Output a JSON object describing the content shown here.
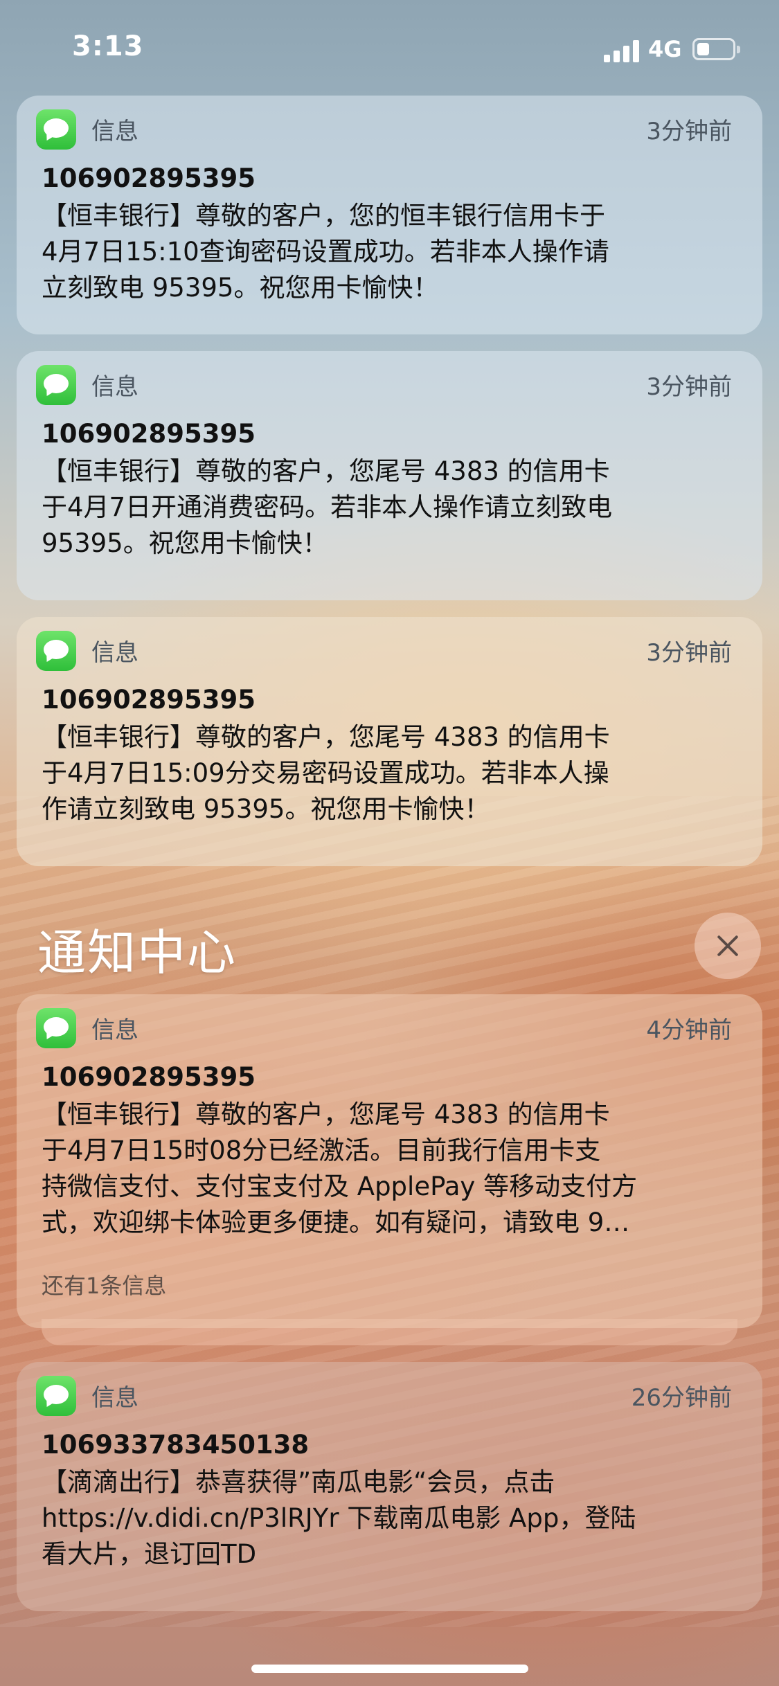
{
  "status_bar": {
    "time": "3:13",
    "network": "4G"
  },
  "notification_center": {
    "title": "通知中心"
  },
  "notifications": [
    {
      "app": "信息",
      "time_ago": "3分钟前",
      "sender": "106902895395",
      "lines": [
        "【恒丰银行】尊敬的客户，您的恒丰银行信用卡于",
        "4月7日15:10查询密码设置成功。若非本人操作请",
        "立刻致电 95395。祝您用卡愉快！"
      ]
    },
    {
      "app": "信息",
      "time_ago": "3分钟前",
      "sender": "106902895395",
      "lines": [
        "【恒丰银行】尊敬的客户，您尾号 4383 的信用卡",
        "于4月7日开通消费密码。若非本人操作请立刻致电",
        "95395。祝您用卡愉快！"
      ]
    },
    {
      "app": "信息",
      "time_ago": "3分钟前",
      "sender": "106902895395",
      "lines": [
        "【恒丰银行】尊敬的客户，您尾号 4383 的信用卡",
        "于4月7日15:09分交易密码设置成功。若非本人操",
        "作请立刻致电 95395。祝您用卡愉快！"
      ]
    },
    {
      "app": "信息",
      "time_ago": "4分钟前",
      "sender": "106902895395",
      "lines": [
        "【恒丰银行】尊敬的客户，您尾号 4383 的信用卡",
        "于4月7日15时08分已经激活。目前我行信用卡支",
        "持微信支付、支付宝支付及 ApplePay 等移动支付方",
        "式，欢迎绑卡体验更多便捷。如有疑问，请致电 9…"
      ],
      "more": "还有1条信息"
    },
    {
      "app": "信息",
      "time_ago": "26分钟前",
      "sender": "106933783450138",
      "lines": [
        "【滴滴出行】恭喜获得”南瓜电影“会员，点击",
        "https://v.didi.cn/P3lRJYr 下载南瓜电影 App，登陆",
        "看大片，退订回TD"
      ]
    }
  ]
}
